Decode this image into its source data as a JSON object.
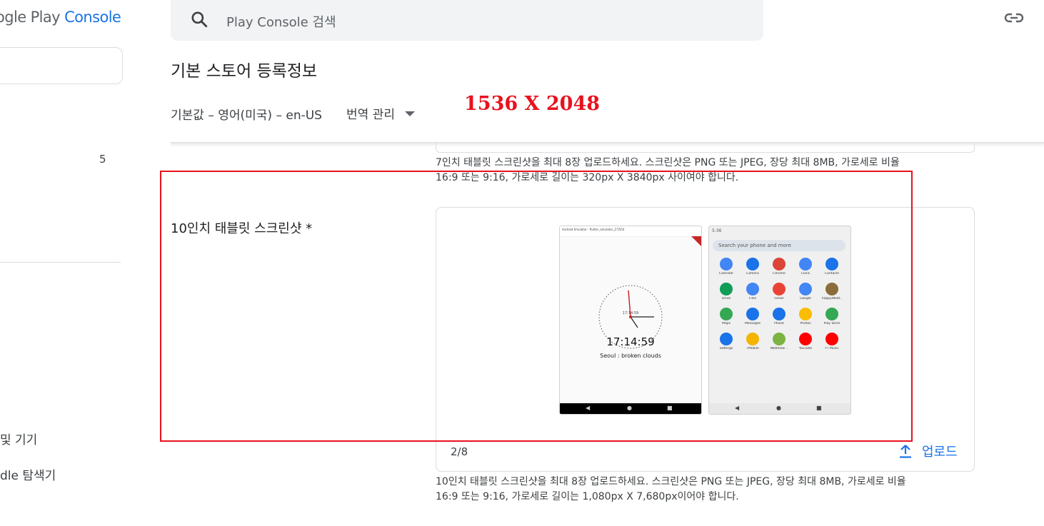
{
  "sidebar": {
    "brand_prefix": "ogle Play ",
    "brand_console": "Console",
    "count": "5",
    "item_devices": "및 기기",
    "item_bundle": "dle 탐색기"
  },
  "header": {
    "search_placeholder": "Play Console 검색",
    "page_title": "기본 스토어 등록정보",
    "locale": "기본값 – 영어(미국) – en-US",
    "translate_label": "번역 관리"
  },
  "annotation": {
    "dimensions": "1536 X 2048"
  },
  "seven_inch": {
    "help_line1": "7인치 태블릿 스크린샷을 최대 8장 업로드하세요. 스크린샷은 PNG 또는 JPEG, 장당 최대 8MB, 가로세로 비율",
    "help_line2": "16:9 또는 9:16, 가로세로 길이는 320px X 3840px 사이여야 합니다."
  },
  "ten_inch": {
    "label": "10인치 태블릿 스크린샷  *",
    "counter": "2/8",
    "upload_label": "업로드",
    "help_line1": "10인치 태블릿 스크린샷을 최대 8장 업로드하세요. 스크린샷은 PNG 또는 JPEG, 장당 최대 8MB, 가로세로 비율",
    "help_line2": "16:9 또는 9:16, 가로세로 길이는 1,080px X 7,680px이어야 합니다."
  },
  "screenshot1": {
    "titlebar": "Android Emulator - flutter_emulator_2:5554",
    "clock_center": "17:14:59",
    "time": "17:14:59",
    "weather": "Seoul : broken clouds"
  },
  "screenshot2": {
    "status_time": "5:36",
    "search": "Search your phone and more",
    "apps": [
      {
        "name": "Calendar",
        "color": "#4285f4"
      },
      {
        "name": "Camera",
        "color": "#1a73e8"
      },
      {
        "name": "Chrome",
        "color": "#db4437"
      },
      {
        "name": "Clock",
        "color": "#4285f4"
      },
      {
        "name": "Contacts",
        "color": "#1a73e8"
      },
      {
        "name": "Drive",
        "color": "#0f9d58"
      },
      {
        "name": "Files",
        "color": "#4285f4"
      },
      {
        "name": "Gmail",
        "color": "#ea4335"
      },
      {
        "name": "Google",
        "color": "#4285f4"
      },
      {
        "name": "happyWeat..",
        "color": "#8a6d3b"
      },
      {
        "name": "Maps",
        "color": "#34a853"
      },
      {
        "name": "Messages",
        "color": "#1a73e8"
      },
      {
        "name": "Phone",
        "color": "#1a73e8"
      },
      {
        "name": "Photos",
        "color": "#fbbc04"
      },
      {
        "name": "Play Store",
        "color": "#34a853"
      },
      {
        "name": "Settings",
        "color": "#1a73e8"
      },
      {
        "name": "TMobile",
        "color": "#f4b400"
      },
      {
        "name": "WebView ..",
        "color": "#7cb342"
      },
      {
        "name": "YouTube",
        "color": "#ff0000"
      },
      {
        "name": "YT Music",
        "color": "#ff0000"
      }
    ]
  },
  "colors": {
    "accent": "#1a73e8",
    "annotation_red": "#e8121e"
  }
}
